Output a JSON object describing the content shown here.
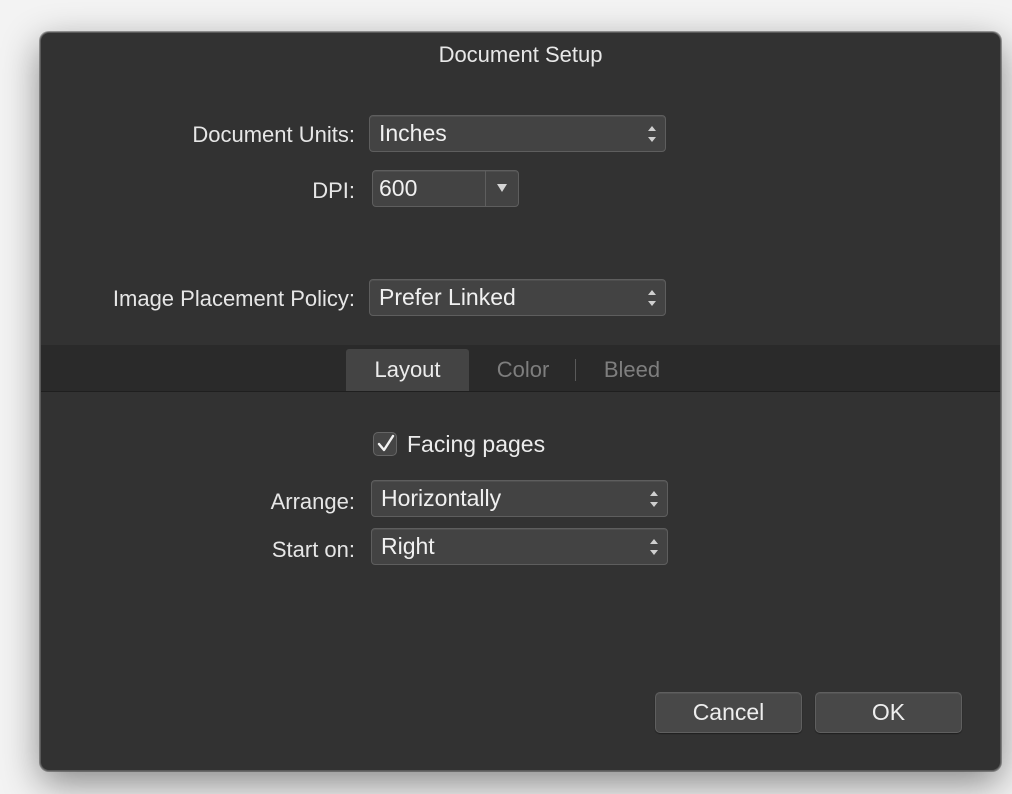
{
  "window": {
    "title": "Document Setup"
  },
  "fields": {
    "document_units": {
      "label": "Document Units:",
      "value": "Inches"
    },
    "dpi": {
      "label": "DPI:",
      "value": "600"
    },
    "image_placement": {
      "label": "Image Placement Policy:",
      "value": "Prefer Linked"
    }
  },
  "tabs": [
    {
      "label": "Layout",
      "active": true
    },
    {
      "label": "Color",
      "active": false
    },
    {
      "label": "Bleed",
      "active": false
    }
  ],
  "layout": {
    "facing_pages": {
      "label": "Facing pages",
      "checked": true
    },
    "arrange": {
      "label": "Arrange:",
      "value": "Horizontally"
    },
    "start_on": {
      "label": "Start on:",
      "value": "Right"
    }
  },
  "buttons": {
    "cancel": "Cancel",
    "ok": "OK"
  },
  "icons": {
    "stepper": "up-down-arrows-icon",
    "dropdown": "triangle-down-icon",
    "checkmark": "checkmark-icon"
  },
  "colors": {
    "window_bg": "#323232",
    "control_bg": "#434343",
    "tabbar_bg": "#2a2a2a"
  }
}
